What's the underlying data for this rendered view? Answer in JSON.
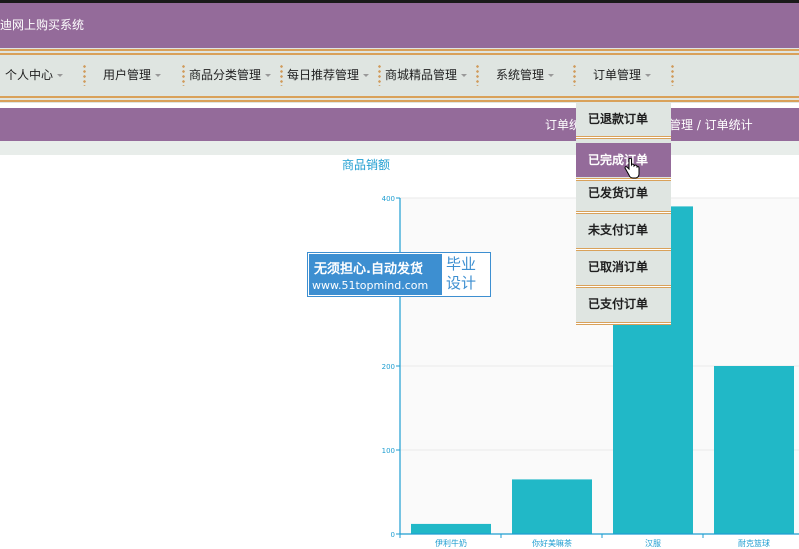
{
  "header": {
    "title": "迪网上购买系统"
  },
  "nav": {
    "items": [
      {
        "label": "个人中心"
      },
      {
        "label": "用户管理"
      },
      {
        "label": "商品分类管理"
      },
      {
        "label": "每日推荐管理"
      },
      {
        "label": "商城精品管理"
      },
      {
        "label": "系统管理"
      },
      {
        "label": "订单管理"
      }
    ]
  },
  "breadcrumb": {
    "left": "订单统",
    "right": "管理 / 订单统计"
  },
  "dropdown": {
    "items": [
      {
        "label": "已退款订单"
      },
      {
        "label": "已完成订单",
        "active": true
      },
      {
        "label": "已发货订单"
      },
      {
        "label": "未支付订单"
      },
      {
        "label": "已取消订单"
      },
      {
        "label": "已支付订单"
      }
    ]
  },
  "watermark": {
    "line1": "无须担心.自动发货",
    "line2": "www.51topmind.com",
    "tag1": "毕业",
    "tag2": "设计"
  },
  "colors": {
    "header": "#946b9a",
    "nav": "#dfe5e1",
    "bar": "#21b8c7",
    "axis": "#1f9ed1",
    "stripe": "#d9a15a"
  },
  "chart_data": {
    "type": "bar",
    "title": "商品销额",
    "categories": [
      "伊利牛奶",
      "你好美嘛茶",
      "汉服",
      "耐克篮球"
    ],
    "values": [
      12,
      65,
      390,
      200
    ],
    "yticks": [
      0,
      100,
      200,
      400
    ],
    "ylim": [
      0,
      400
    ],
    "grid": true
  }
}
